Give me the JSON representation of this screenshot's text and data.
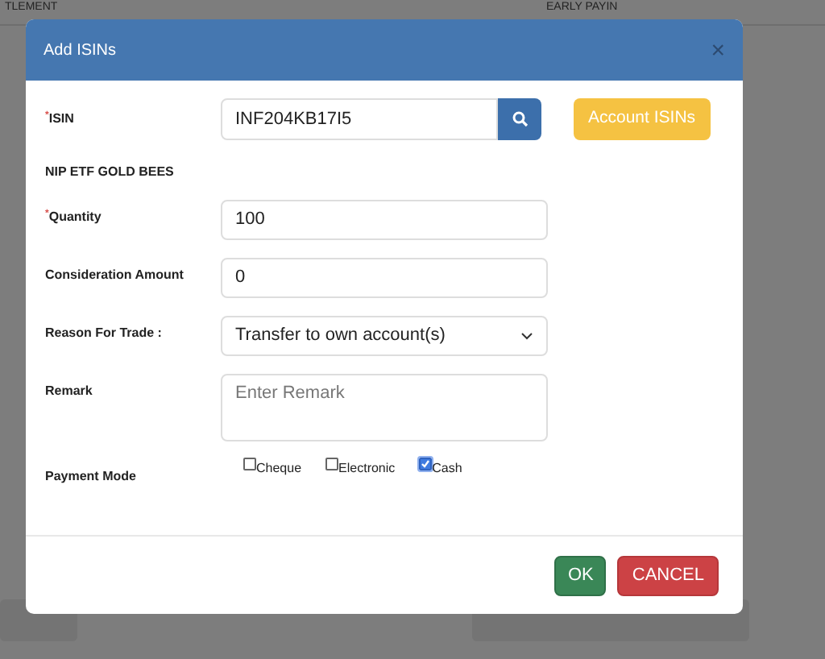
{
  "background": {
    "columns": [
      "TLEMENT",
      "EARLY PAYIN"
    ]
  },
  "dialog": {
    "title": "Add ISINs",
    "close": "×",
    "isin": {
      "label": "ISIN",
      "required_mark": "*",
      "value": "INF204KB17I5",
      "action": "Account ISINs"
    },
    "security_name": "NIP ETF GOLD BEES",
    "quantity": {
      "label": "Quantity",
      "required_mark": "*",
      "value": "100"
    },
    "consideration": {
      "label": "Consideration Amount",
      "value": "0"
    },
    "reason": {
      "label": "Reason For Trade :",
      "value": "Transfer to own account(s)"
    },
    "remark": {
      "label": "Remark",
      "placeholder": "Enter Remark"
    },
    "payment_mode": {
      "label": "Payment Mode",
      "options": [
        {
          "label": "Cheque",
          "checked": false
        },
        {
          "label": "Electronic",
          "checked": false
        },
        {
          "label": "Cash",
          "checked": true
        }
      ]
    },
    "buttons": [
      {
        "label": "OK",
        "kind": "ok"
      },
      {
        "label": "CANCEL",
        "kind": "cancel"
      }
    ]
  }
}
